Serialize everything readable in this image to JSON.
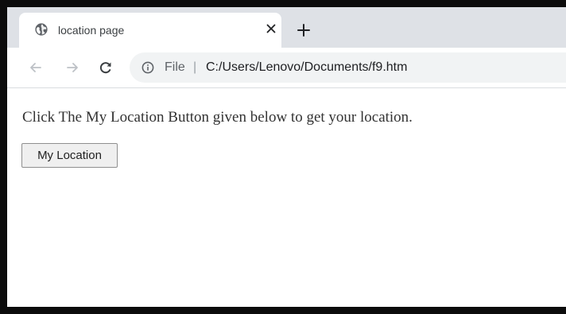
{
  "browser": {
    "tab": {
      "title": "location page",
      "favicon": "globe-icon",
      "close_icon": "close-icon"
    },
    "new_tab_icon": "plus-icon",
    "toolbar": {
      "back_icon": "back-arrow-icon",
      "forward_icon": "forward-arrow-icon",
      "reload_icon": "reload-icon",
      "site_info_icon": "info-icon",
      "scheme_label": "File",
      "separator": "|",
      "url": "C:/Users/Lenovo/Documents/f9.htm"
    }
  },
  "page": {
    "instruction": "Click The My Location Button given below to get your location.",
    "button_label": "My Location"
  },
  "colors": {
    "frame_border": "#0c0c0c",
    "tabstrip_bg": "#dee1e6",
    "omnibox_bg": "#f1f3f4",
    "button_bg": "#efefef",
    "text": "#333333"
  }
}
